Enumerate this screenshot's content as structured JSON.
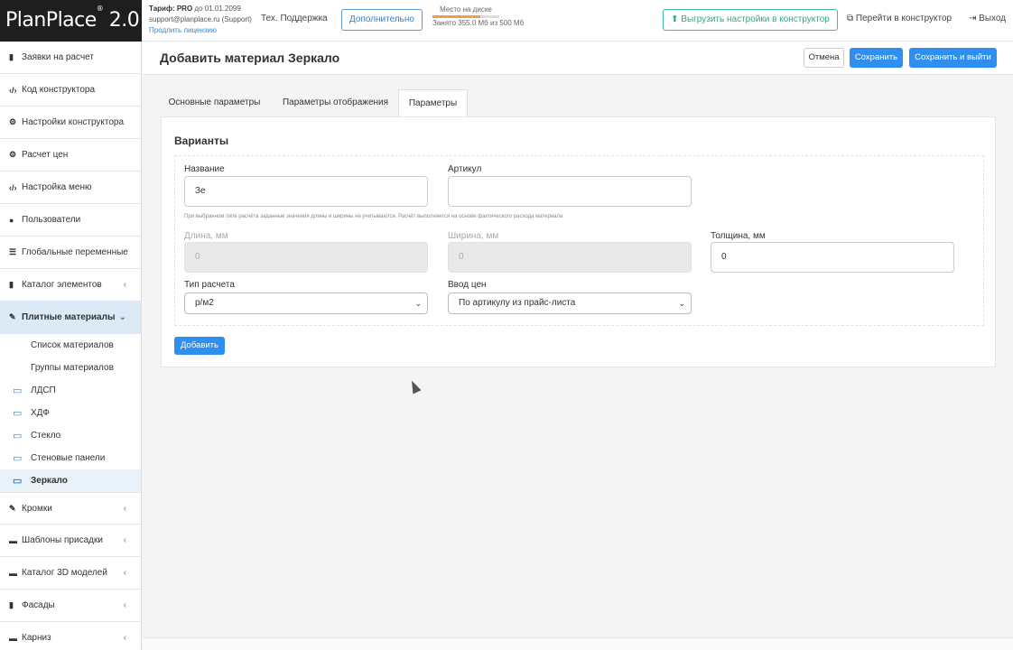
{
  "header": {
    "logo": "PlanPlace",
    "logo_version": "2.0",
    "tariff_label": "Тариф:",
    "tariff_plan": "PRO",
    "tariff_until": "до 01.01.2099",
    "email": "support@planplace.ru (Support)",
    "renew": "Продлить лицензию",
    "support": "Тех. Поддержка",
    "more": "Дополнительно",
    "disk_title": "Место на диске",
    "disk_used": "Занято 355.0 Мб из 500 Мб",
    "disk_fraction": 0.71,
    "export": "Выгрузить настройки в конструктор",
    "goto": "Перейти в конструктор",
    "logout": "Выход"
  },
  "sidebar": {
    "items": [
      {
        "label": "Заявки на расчет",
        "icon": "document-icon"
      },
      {
        "label": "Код конструктора",
        "icon": "code-icon"
      },
      {
        "label": "Настройки конструктора",
        "icon": "gears-icon"
      },
      {
        "label": "Расчет цен",
        "icon": "gears-icon"
      },
      {
        "label": "Настройка меню",
        "icon": "code-icon"
      },
      {
        "label": "Пользователи",
        "icon": "user-icon"
      },
      {
        "label": "Глобальные переменные",
        "icon": "list-icon"
      },
      {
        "label": "Каталог элементов",
        "icon": "book-icon"
      },
      {
        "label": "Плитные материалы",
        "icon": "brush-icon"
      }
    ],
    "sub": [
      "Список материалов",
      "Группы материалов"
    ],
    "groups": [
      "ЛДСП",
      "ХДФ",
      "Стекло",
      "Стеновые панели",
      "Зеркало"
    ],
    "bottom": [
      {
        "label": "Кромки",
        "icon": "brush-icon"
      },
      {
        "label": "Шаблоны присадки",
        "icon": "template-icon"
      },
      {
        "label": "Каталог 3D моделей",
        "icon": "model-icon"
      },
      {
        "label": "Фасады",
        "icon": "facade-icon"
      },
      {
        "label": "Карниз",
        "icon": "cornice-icon"
      }
    ]
  },
  "page": {
    "title": "Добавить материал Зеркало",
    "cancel": "Отмена",
    "save": "Сохранить",
    "save_exit": "Сохранить и выйти"
  },
  "tabs": [
    "Основные параметры",
    "Параметры отображения",
    "Параметры"
  ],
  "form": {
    "section": "Варианты",
    "name_label": "Название",
    "name_value": "Зе",
    "article_label": "Артикул",
    "article_value": "",
    "hint": "При выбранном типе расчёта заданные значения длины и ширины не учитываются. Расчёт выполняется на основе фактического расхода материала",
    "length_label": "Длина, мм",
    "length_value": "0",
    "width_label": "Ширина, мм",
    "width_value": "0",
    "thickness_label": "Толщина, мм",
    "thickness_value": "0",
    "calc_label": "Тип расчета",
    "calc_value": "р/м2",
    "price_label": "Ввод цен",
    "price_value": "По артикулу из прайс-листа",
    "add": "Добавить"
  }
}
